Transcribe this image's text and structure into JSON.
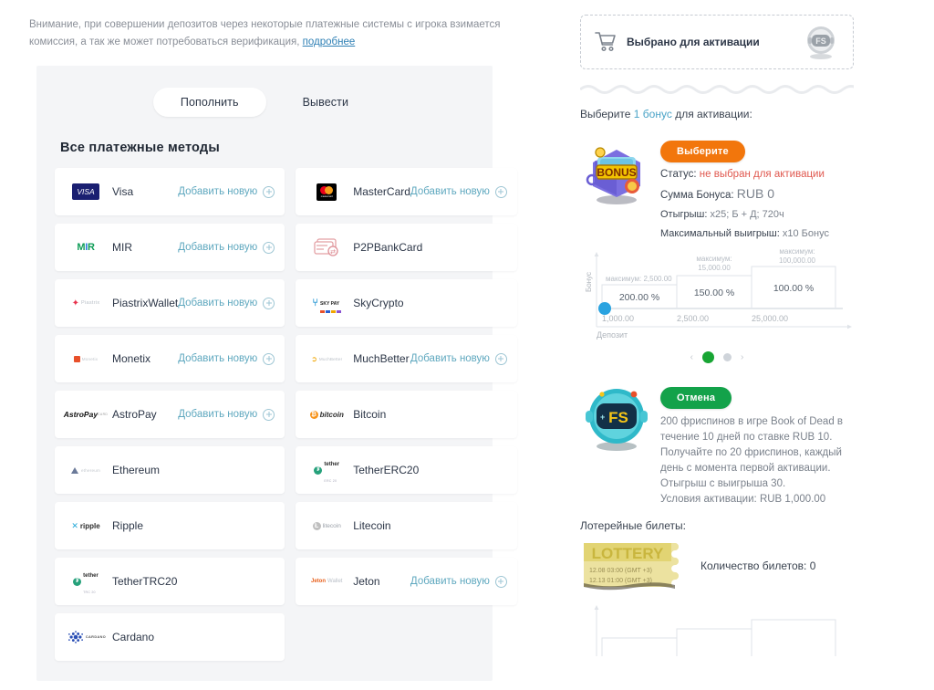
{
  "notice": {
    "text_before": "Внимание, при совершении депозитов через некоторые платежные системы с игрока взимается комиссия, а так же может потребоваться верификация,",
    "link": "подробнее"
  },
  "tabs": [
    {
      "label": "Пополнить",
      "active": true
    },
    {
      "label": "Вывести",
      "active": false
    }
  ],
  "payments": {
    "title": "Все платежные методы",
    "add_label": "Добавить новую",
    "methods": [
      {
        "name": "Visa",
        "logo": "visa-logo",
        "add": true
      },
      {
        "name": "MasterCard",
        "logo": "mastercard-logo",
        "add": true
      },
      {
        "name": "MIR",
        "logo": "mir-logo",
        "add": true
      },
      {
        "name": "P2PBankCard",
        "logo": "p2pbankcard-logo",
        "add": false
      },
      {
        "name": "PiastrixWallet",
        "logo": "piastrix-logo",
        "add": true
      },
      {
        "name": "SkyCrypto",
        "logo": "skypay-logo",
        "add": false
      },
      {
        "name": "Monetix",
        "logo": "monetix-logo",
        "add": true
      },
      {
        "name": "MuchBetter",
        "logo": "muchbetter-logo",
        "add": true
      },
      {
        "name": "AstroPay",
        "logo": "astropay-logo",
        "add": true
      },
      {
        "name": "Bitcoin",
        "logo": "bitcoin-logo",
        "add": false
      },
      {
        "name": "Ethereum",
        "logo": "ethereum-logo",
        "add": false
      },
      {
        "name": "TetherERC20",
        "logo": "tether-erc20-logo",
        "add": false
      },
      {
        "name": "Ripple",
        "logo": "ripple-logo",
        "add": false
      },
      {
        "name": "Litecoin",
        "logo": "litecoin-logo",
        "add": false
      },
      {
        "name": "TetherTRC20",
        "logo": "tether-trc20-logo",
        "add": false
      },
      {
        "name": "Jeton",
        "logo": "jeton-logo",
        "add": true
      },
      {
        "name": "Cardano",
        "logo": "cardano-logo",
        "add": false
      }
    ]
  },
  "cart": {
    "label": "Выбрано для активации",
    "icon": "shopping-cart-icon",
    "avatar": "bonus-robot-avatar"
  },
  "choose": {
    "prefix": "Выберите",
    "highlight": "1 бонус",
    "suffix": "для активации:"
  },
  "bonus_card": {
    "button": "Выберите",
    "status_label": "Статус:",
    "status_value": "не выбран для активации",
    "amount_label": "Сумма Бонуса:",
    "amount_value": "RUB 0",
    "wager_label": "Отыгрыш:",
    "wager_value": "x25; Б + Д; 720ч",
    "maxwin_label": "Максимальный выигрыш:",
    "maxwin_value": "x10 Бонус"
  },
  "carousel": {
    "prev": "‹",
    "next": "›",
    "dots": [
      {
        "active": true
      },
      {
        "active": false
      }
    ]
  },
  "fs_card": {
    "button": "Отмена",
    "description": "200 фриспинов в игре Book of Dead в течение 10 дней по ставке RUB 10. Получайте по 20 фриспинов, каждый день с момента первой активации. Отыгрыш с выигрыша 30.",
    "cond_label": "Условия активации:",
    "cond_value": "RUB 1,000.00"
  },
  "lottery": {
    "title": "Лотерейные билеты:",
    "ticket_word": "LOTTERY",
    "date1": "12.08 03:00 (GMT +3)",
    "date2": "12.13 01:00 (GMT +3)",
    "count_label": "Количество билетов: 0"
  },
  "chart_data": {
    "type": "bar",
    "title": "",
    "xlabel": "Депозит",
    "ylabel": "Бонус",
    "categories": [
      "1,000.00",
      "2,500.00",
      "25,000.00"
    ],
    "values": [
      200,
      150,
      100
    ],
    "value_labels": [
      "200.00 %",
      "150.00 %",
      "100.00 %"
    ],
    "max_prefix": "максимум:",
    "max_labels": [
      "максимум: 2,500.00",
      "максимум: 15,000.00",
      "максимум: 100,000.00"
    ],
    "max_values": [
      2500,
      15000,
      100000
    ],
    "tick_labels": [
      "1,000.00",
      "2,500.00",
      "25,000.00"
    ],
    "handle_position": 0,
    "ylim": [
      0,
      100000
    ],
    "grid": false,
    "legend": "none"
  }
}
